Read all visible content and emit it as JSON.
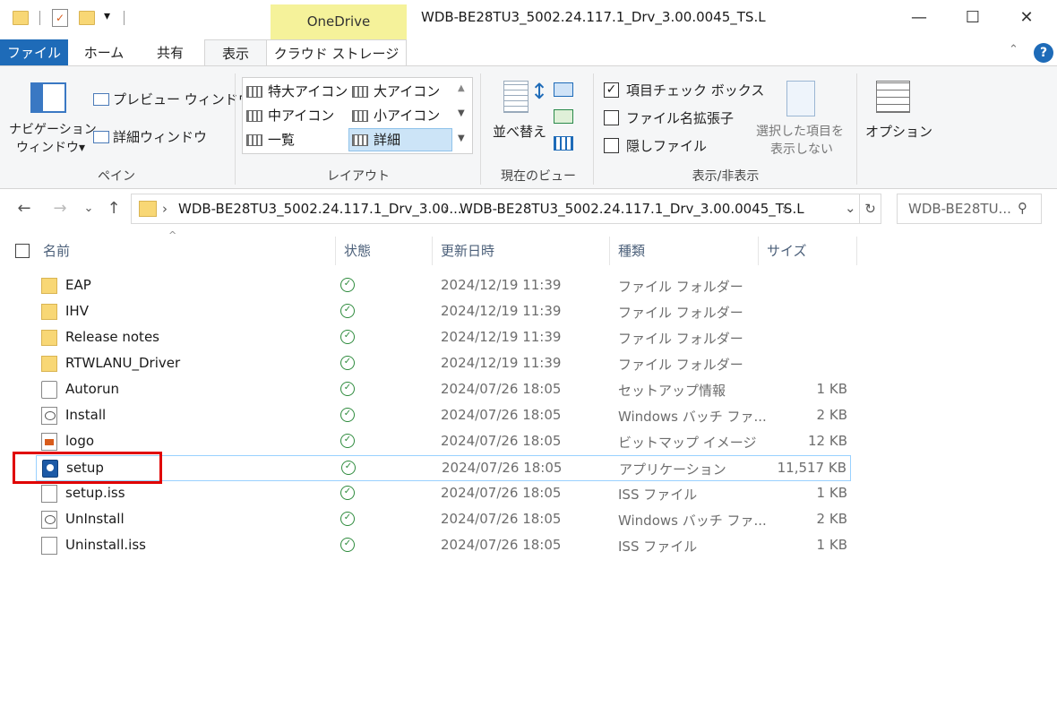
{
  "title_bar": {
    "contextual_tab": "OneDrive",
    "window_title": "WDB-BE28TU3_5002.24.117.1_Drv_3.00.0045_TS.L",
    "qat_dropdown": "▾",
    "minimize": "—",
    "maximize": "☐",
    "close": "✕"
  },
  "ribbon_tabs": {
    "file": "ファイル",
    "home": "ホーム",
    "share": "共有",
    "view": "表示",
    "cloud_storage": "クラウド ストレージ",
    "help": "?",
    "collapse": "⌃"
  },
  "ribbon": {
    "pane": {
      "nav_pane_line1": "ナビゲーション",
      "nav_pane_line2": "ウィンドウ▾",
      "preview": "プレビュー ウィンドウ",
      "details": "詳細ウィンドウ",
      "label": "ペイン"
    },
    "layout": {
      "extra_large": "特大アイコン",
      "large": "大アイコン",
      "medium": "中アイコン",
      "small": "小アイコン",
      "list": "一覧",
      "details": "詳細",
      "label": "レイアウト"
    },
    "current_view": {
      "sort": "並べ替え",
      "label": "現在のビュー"
    },
    "show_hide": {
      "item_checkbox": "項目チェック ボックス",
      "item_checkbox_checked": "✓",
      "extensions": "ファイル名拡張子",
      "hidden": "隠しファイル",
      "hide_selected_line1": "選択した項目を",
      "hide_selected_line2": "表示しない",
      "label": "表示/非表示"
    },
    "options": "オプション"
  },
  "address_bar": {
    "back": "←",
    "forward": "→",
    "recent": "⌄",
    "up": "↑",
    "crumb1": "WDB-BE28TU3_5002.24.117.1_Drv_3.00...",
    "crumb2": "WDB-BE28TU3_5002.24.117.1_Drv_3.00.0045_TS.L",
    "sep": "›",
    "dropdown": "⌄",
    "refresh": "↻",
    "search_placeholder": "WDB-BE28TU...",
    "search_icon": "⚲"
  },
  "columns": {
    "name": "名前",
    "status": "状態",
    "modified": "更新日時",
    "type": "種類",
    "size": "サイズ",
    "sort_caret": "^"
  },
  "status_mark": "✓",
  "files": [
    {
      "name": "EAP",
      "date": "2024/12/19 11:39",
      "type": "ファイル フォルダー",
      "size": "",
      "icon": "folder"
    },
    {
      "name": "IHV",
      "date": "2024/12/19 11:39",
      "type": "ファイル フォルダー",
      "size": "",
      "icon": "folder"
    },
    {
      "name": "Release notes",
      "date": "2024/12/19 11:39",
      "type": "ファイル フォルダー",
      "size": "",
      "icon": "folder"
    },
    {
      "name": "RTWLANU_Driver",
      "date": "2024/12/19 11:39",
      "type": "ファイル フォルダー",
      "size": "",
      "icon": "folder"
    },
    {
      "name": "Autorun",
      "date": "2024/07/26 18:05",
      "type": "セットアップ情報",
      "size": "1 KB",
      "icon": "gear"
    },
    {
      "name": "Install",
      "date": "2024/07/26 18:05",
      "type": "Windows バッチ ファ...",
      "size": "2 KB",
      "icon": "bat"
    },
    {
      "name": "logo",
      "date": "2024/07/26 18:05",
      "type": "ビットマップ イメージ",
      "size": "12 KB",
      "icon": "img"
    },
    {
      "name": "setup",
      "date": "2024/07/26 18:05",
      "type": "アプリケーション",
      "size": "11,517 KB",
      "icon": "app"
    },
    {
      "name": "setup.iss",
      "date": "2024/07/26 18:05",
      "type": "ISS ファイル",
      "size": "1 KB",
      "icon": "doc"
    },
    {
      "name": "UnInstall",
      "date": "2024/07/26 18:05",
      "type": "Windows バッチ ファ...",
      "size": "2 KB",
      "icon": "bat"
    },
    {
      "name": "Uninstall.iss",
      "date": "2024/07/26 18:05",
      "type": "ISS ファイル",
      "size": "1 KB",
      "icon": "doc"
    }
  ],
  "colors": {
    "accent": "#1e6bb8",
    "highlight_box": "#e00000",
    "status_ok": "#2e8b3d"
  }
}
